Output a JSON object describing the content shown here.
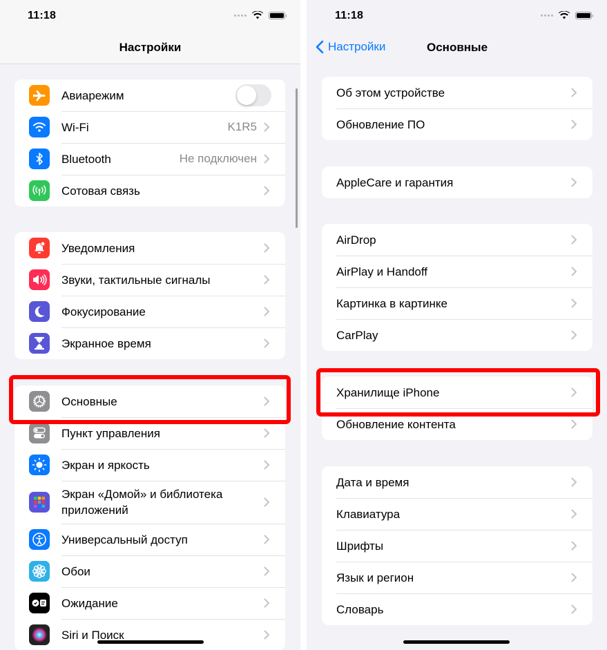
{
  "left_screen": {
    "status_bar": {
      "time": "11:18"
    },
    "nav_title": "Настройки",
    "groups": [
      [
        {
          "label": "Авиарежим",
          "icon": "airplane-icon",
          "icon_color": "#ff9500",
          "control": "toggle",
          "toggle_on": false
        },
        {
          "label": "Wi-Fi",
          "icon": "wifi-icon",
          "icon_color": "#0a7aff",
          "value": "K1R5"
        },
        {
          "label": "Bluetooth",
          "icon": "bluetooth-icon",
          "icon_color": "#0a7aff",
          "value": "Не подключен"
        },
        {
          "label": "Сотовая связь",
          "icon": "cellular-icon",
          "icon_color": "#30c75a"
        }
      ],
      [
        {
          "label": "Уведомления",
          "icon": "notifications-icon",
          "icon_color": "#fe3b30"
        },
        {
          "label": "Звуки, тактильные сигналы",
          "icon": "sound-icon",
          "icon_color": "#fe2d55"
        },
        {
          "label": "Фокусирование",
          "icon": "moon-icon",
          "icon_color": "#5856d6"
        },
        {
          "label": "Экранное время",
          "icon": "hourglass-icon",
          "icon_color": "#5856d6"
        }
      ],
      [
        {
          "label": "Основные",
          "icon": "gear-icon",
          "icon_color": "#8e8e93",
          "highlighted": true
        },
        {
          "label": "Пункт управления",
          "icon": "control-center-icon",
          "icon_color": "#8e8e93"
        },
        {
          "label": "Экран и яркость",
          "icon": "brightness-icon",
          "icon_color": "#0a7aff"
        },
        {
          "label": "Экран «Домой» и библиотека приложений",
          "icon": "home-screen-icon",
          "icon_color": "#5a55d8"
        },
        {
          "label": "Универсальный доступ",
          "icon": "accessibility-icon",
          "icon_color": "#0a7aff"
        },
        {
          "label": "Обои",
          "icon": "wallpaper-icon",
          "icon_color": "#30b0e8"
        },
        {
          "label": "Ожидание",
          "icon": "standby-icon",
          "icon_color": "#000000"
        },
        {
          "label": "Siri и Поиск",
          "icon": "siri-icon",
          "icon_color": "#222222"
        }
      ]
    ]
  },
  "right_screen": {
    "status_bar": {
      "time": "11:18"
    },
    "back_label": "Настройки",
    "nav_title": "Основные",
    "groups": [
      [
        {
          "label": "Об этом устройстве"
        },
        {
          "label": "Обновление ПО"
        }
      ],
      [
        {
          "label": "AppleCare и гарантия"
        }
      ],
      [
        {
          "label": "AirDrop"
        },
        {
          "label": "AirPlay и Handoff"
        },
        {
          "label": "Картинка в картинке"
        },
        {
          "label": "CarPlay"
        }
      ],
      [
        {
          "label": "Хранилище iPhone",
          "highlighted": true
        },
        {
          "label": "Обновление контента"
        }
      ],
      [
        {
          "label": "Дата и время"
        },
        {
          "label": "Клавиатура"
        },
        {
          "label": "Шрифты"
        },
        {
          "label": "Язык и регион"
        },
        {
          "label": "Словарь"
        }
      ]
    ]
  },
  "colors": {
    "accent": "#0a7aff",
    "highlight": "#fe0000",
    "background": "#f2f2f7"
  }
}
